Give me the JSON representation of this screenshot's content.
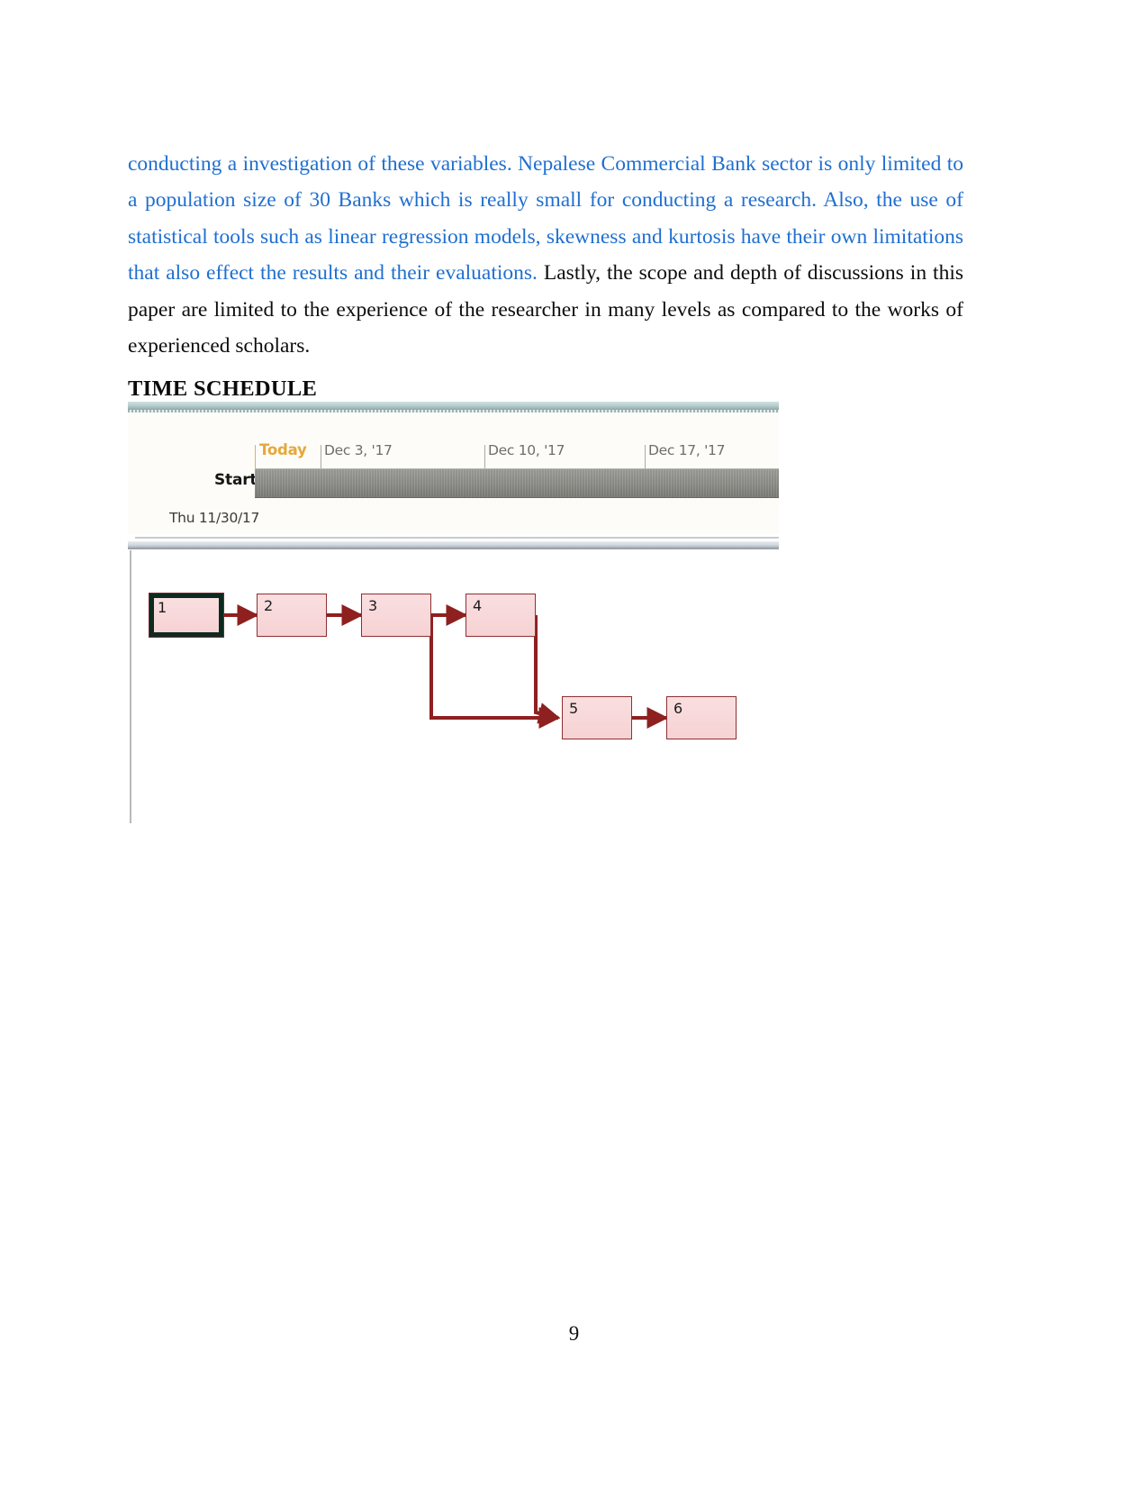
{
  "document": {
    "page_number": "9",
    "paragraph": {
      "blue_part": "conducting a investigation of these variables. Nepalese Commercial Bank sector is only limited to a population size of 30 Banks which is really small for conducting a research. Also, the use of statistical tools such as linear regression models, skewness and kurtosis have their own limitations that also effect the results and their evaluations.",
      "black_part": " Lastly, the scope and depth of discussions in this paper are limited to the experience of the researcher in many levels as compared to the works of experienced scholars."
    },
    "heading": "TIME SCHEDULE"
  },
  "figure": {
    "gantt": {
      "today_label": "Today",
      "row_label": "Start",
      "row_date": "Thu 11/30/17",
      "timeline_dates": [
        "Dec 3, '17",
        "Dec 10, '17",
        "Dec 17, '17"
      ],
      "today_color": "#e5a83a",
      "bar_color": "#8d8d88"
    },
    "network": {
      "node_fill": "#f6d2d4",
      "node_border": "#8e2f31",
      "connector_color": "#8e2020",
      "selected_border": "#0e2a20",
      "nodes": [
        {
          "id": "1",
          "label": "1",
          "selected": true
        },
        {
          "id": "2",
          "label": "2",
          "selected": false
        },
        {
          "id": "3",
          "label": "3",
          "selected": false
        },
        {
          "id": "4",
          "label": "4",
          "selected": false
        },
        {
          "id": "5",
          "label": "5",
          "selected": false
        },
        {
          "id": "6",
          "label": "6",
          "selected": false
        }
      ],
      "links": [
        {
          "from": "1",
          "to": "2"
        },
        {
          "from": "2",
          "to": "3"
        },
        {
          "from": "3",
          "to": "4"
        },
        {
          "from": "3",
          "to": "5"
        },
        {
          "from": "4",
          "to": "5"
        },
        {
          "from": "5",
          "to": "6"
        }
      ]
    }
  }
}
